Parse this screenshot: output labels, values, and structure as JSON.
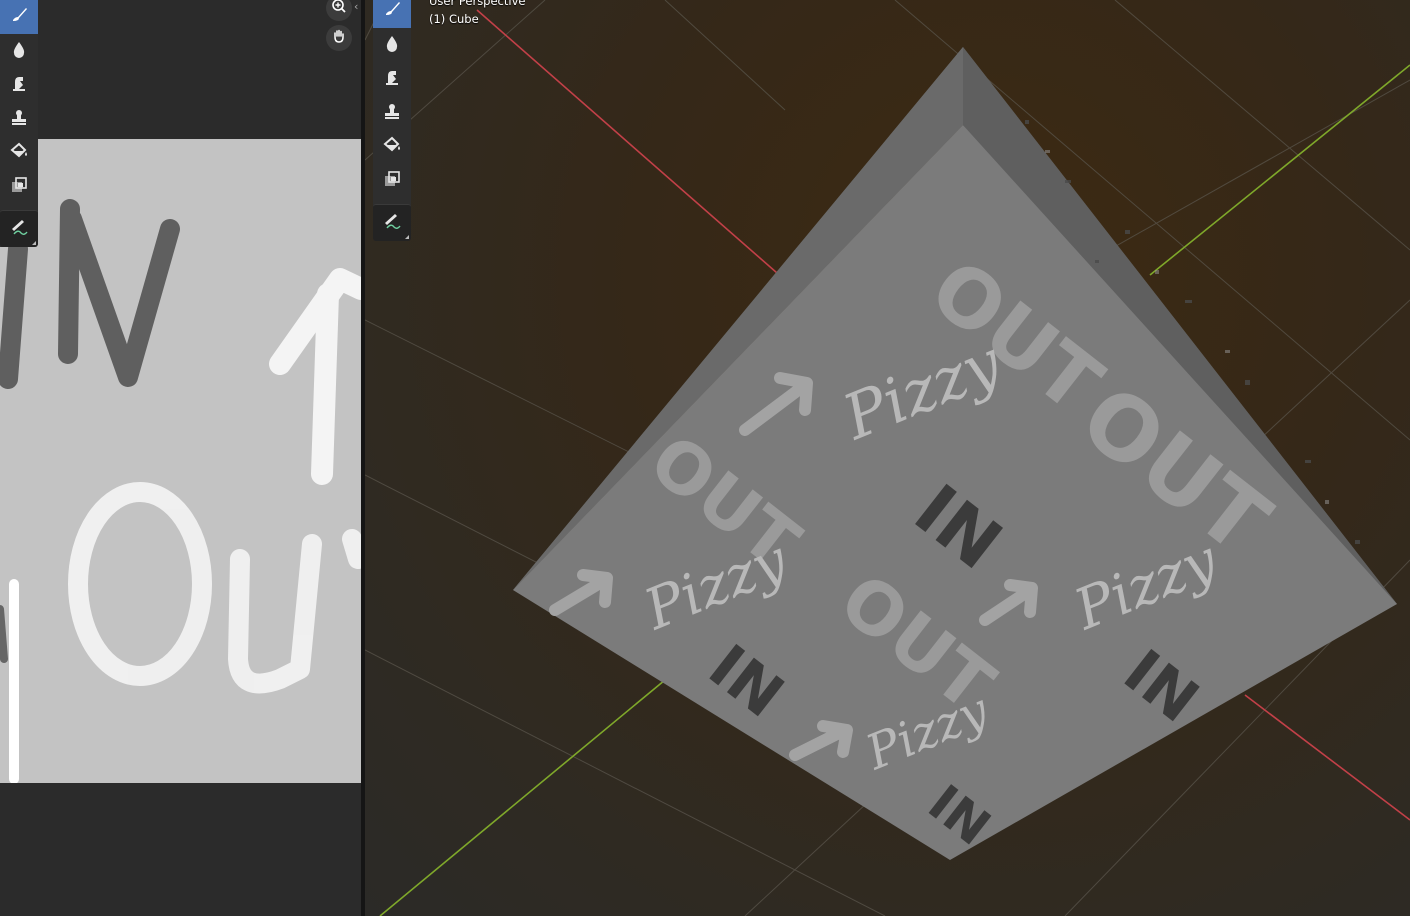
{
  "image_editor": {
    "tools": [
      {
        "name": "brush-tool-icon",
        "active": true
      },
      {
        "name": "blur-tool-icon",
        "active": false
      },
      {
        "name": "smear-tool-icon",
        "active": false
      },
      {
        "name": "clone-tool-icon",
        "active": false
      },
      {
        "name": "fill-tool-icon",
        "active": false
      },
      {
        "name": "mask-tool-icon",
        "active": false
      },
      {
        "name": "annotate-tool-icon",
        "active": false
      }
    ],
    "navigation": [
      "zoom-icon",
      "pan-hand-icon"
    ],
    "canvas_text": {
      "in": "IN",
      "out": "OUT"
    }
  },
  "viewport": {
    "view_name": "User Perspective",
    "object_label": "(1) Cube",
    "colors": {
      "x_axis": "#c24048",
      "y_axis": "#7fa82a",
      "active_tool": "#4772b3"
    },
    "cube_text": {
      "word_out": "OUT",
      "word_in": "IN",
      "signature": "Pizzy"
    }
  }
}
